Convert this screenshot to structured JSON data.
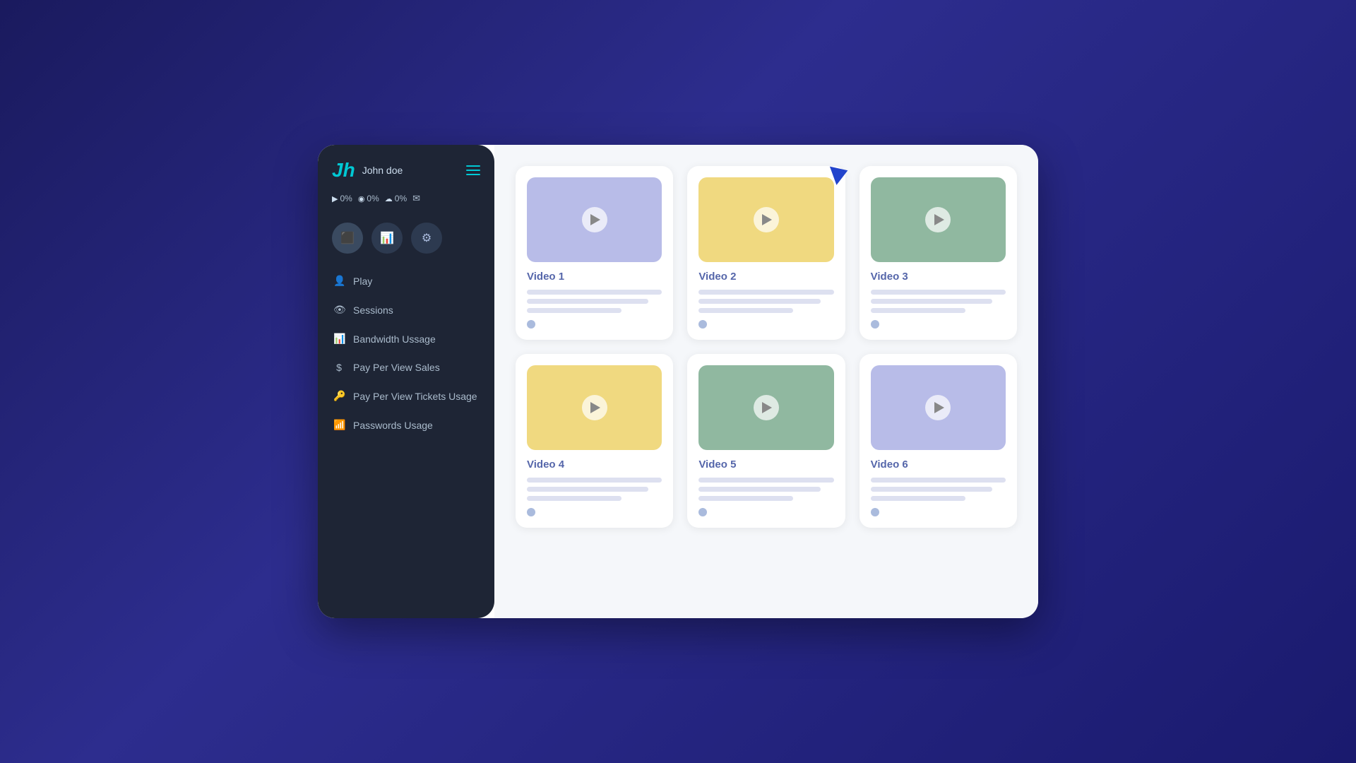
{
  "sidebar": {
    "logo": "Jh",
    "user_name": "John doe",
    "stats": [
      {
        "icon": "▶",
        "value": "0%"
      },
      {
        "icon": "◉",
        "value": "0%"
      },
      {
        "icon": "☁",
        "value": "0%"
      }
    ],
    "icon_buttons": [
      {
        "name": "monitor-icon",
        "symbol": "▣"
      },
      {
        "name": "chart-icon",
        "symbol": "▤"
      },
      {
        "name": "settings-icon",
        "symbol": "⚙"
      }
    ],
    "nav_items": [
      {
        "id": "play",
        "icon": "👤",
        "label": "Play"
      },
      {
        "id": "sessions",
        "icon": "👁",
        "label": "Sessions"
      },
      {
        "id": "bandwidth-ussage",
        "icon": "📊",
        "label": "Bandwidth Ussage"
      },
      {
        "id": "pay-per-view-sales",
        "icon": "$",
        "label": "Pay Per View Sales"
      },
      {
        "id": "ppv-tickets-usage",
        "icon": "🔑",
        "label": "Pay Per View Tickets Usage"
      },
      {
        "id": "passwords-usage",
        "icon": "📶",
        "label": "Passwords Usage"
      }
    ]
  },
  "main": {
    "videos": [
      {
        "id": "video-1",
        "title": "Video 1",
        "thumbnail_class": "thumbnail-purple"
      },
      {
        "id": "video-2",
        "title": "Video 2",
        "thumbnail_class": "thumbnail-yellow"
      },
      {
        "id": "video-3",
        "title": "Video 3",
        "thumbnail_class": "thumbnail-green"
      },
      {
        "id": "video-4",
        "title": "Video 4",
        "thumbnail_class": "thumbnail-yellow"
      },
      {
        "id": "video-5",
        "title": "Video 5",
        "thumbnail_class": "thumbnail-green"
      },
      {
        "id": "video-6",
        "title": "Video 6",
        "thumbnail_class": "thumbnail-purple"
      }
    ]
  }
}
